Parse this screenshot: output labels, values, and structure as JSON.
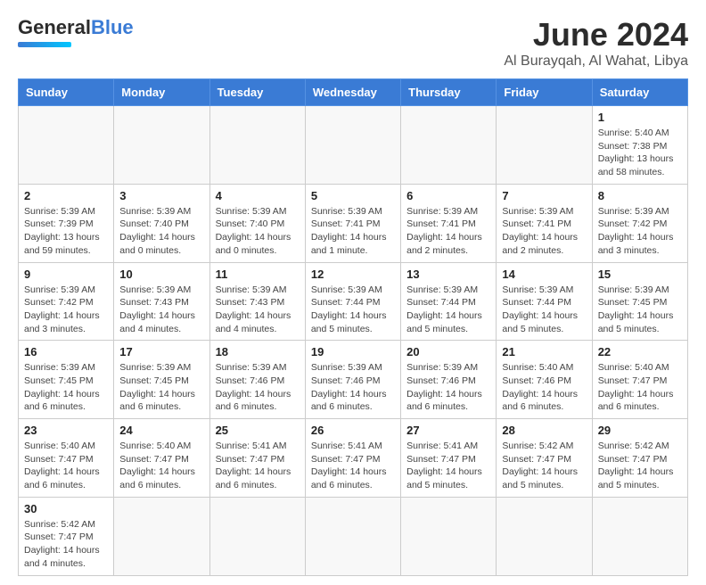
{
  "header": {
    "logo_general": "General",
    "logo_blue": "Blue",
    "title": "June 2024",
    "subtitle": "Al Burayqah, Al Wahat, Libya"
  },
  "days_of_week": [
    "Sunday",
    "Monday",
    "Tuesday",
    "Wednesday",
    "Thursday",
    "Friday",
    "Saturday"
  ],
  "weeks": [
    [
      {
        "day": "",
        "info": ""
      },
      {
        "day": "",
        "info": ""
      },
      {
        "day": "",
        "info": ""
      },
      {
        "day": "",
        "info": ""
      },
      {
        "day": "",
        "info": ""
      },
      {
        "day": "",
        "info": ""
      },
      {
        "day": "1",
        "info": "Sunrise: 5:40 AM\nSunset: 7:38 PM\nDaylight: 13 hours and 58 minutes."
      }
    ],
    [
      {
        "day": "2",
        "info": "Sunrise: 5:39 AM\nSunset: 7:39 PM\nDaylight: 13 hours and 59 minutes."
      },
      {
        "day": "3",
        "info": "Sunrise: 5:39 AM\nSunset: 7:40 PM\nDaylight: 14 hours and 0 minutes."
      },
      {
        "day": "4",
        "info": "Sunrise: 5:39 AM\nSunset: 7:40 PM\nDaylight: 14 hours and 0 minutes."
      },
      {
        "day": "5",
        "info": "Sunrise: 5:39 AM\nSunset: 7:41 PM\nDaylight: 14 hours and 1 minute."
      },
      {
        "day": "6",
        "info": "Sunrise: 5:39 AM\nSunset: 7:41 PM\nDaylight: 14 hours and 2 minutes."
      },
      {
        "day": "7",
        "info": "Sunrise: 5:39 AM\nSunset: 7:41 PM\nDaylight: 14 hours and 2 minutes."
      },
      {
        "day": "8",
        "info": "Sunrise: 5:39 AM\nSunset: 7:42 PM\nDaylight: 14 hours and 3 minutes."
      }
    ],
    [
      {
        "day": "9",
        "info": "Sunrise: 5:39 AM\nSunset: 7:42 PM\nDaylight: 14 hours and 3 minutes."
      },
      {
        "day": "10",
        "info": "Sunrise: 5:39 AM\nSunset: 7:43 PM\nDaylight: 14 hours and 4 minutes."
      },
      {
        "day": "11",
        "info": "Sunrise: 5:39 AM\nSunset: 7:43 PM\nDaylight: 14 hours and 4 minutes."
      },
      {
        "day": "12",
        "info": "Sunrise: 5:39 AM\nSunset: 7:44 PM\nDaylight: 14 hours and 5 minutes."
      },
      {
        "day": "13",
        "info": "Sunrise: 5:39 AM\nSunset: 7:44 PM\nDaylight: 14 hours and 5 minutes."
      },
      {
        "day": "14",
        "info": "Sunrise: 5:39 AM\nSunset: 7:44 PM\nDaylight: 14 hours and 5 minutes."
      },
      {
        "day": "15",
        "info": "Sunrise: 5:39 AM\nSunset: 7:45 PM\nDaylight: 14 hours and 5 minutes."
      }
    ],
    [
      {
        "day": "16",
        "info": "Sunrise: 5:39 AM\nSunset: 7:45 PM\nDaylight: 14 hours and 6 minutes."
      },
      {
        "day": "17",
        "info": "Sunrise: 5:39 AM\nSunset: 7:45 PM\nDaylight: 14 hours and 6 minutes."
      },
      {
        "day": "18",
        "info": "Sunrise: 5:39 AM\nSunset: 7:46 PM\nDaylight: 14 hours and 6 minutes."
      },
      {
        "day": "19",
        "info": "Sunrise: 5:39 AM\nSunset: 7:46 PM\nDaylight: 14 hours and 6 minutes."
      },
      {
        "day": "20",
        "info": "Sunrise: 5:39 AM\nSunset: 7:46 PM\nDaylight: 14 hours and 6 minutes."
      },
      {
        "day": "21",
        "info": "Sunrise: 5:40 AM\nSunset: 7:46 PM\nDaylight: 14 hours and 6 minutes."
      },
      {
        "day": "22",
        "info": "Sunrise: 5:40 AM\nSunset: 7:47 PM\nDaylight: 14 hours and 6 minutes."
      }
    ],
    [
      {
        "day": "23",
        "info": "Sunrise: 5:40 AM\nSunset: 7:47 PM\nDaylight: 14 hours and 6 minutes."
      },
      {
        "day": "24",
        "info": "Sunrise: 5:40 AM\nSunset: 7:47 PM\nDaylight: 14 hours and 6 minutes."
      },
      {
        "day": "25",
        "info": "Sunrise: 5:41 AM\nSunset: 7:47 PM\nDaylight: 14 hours and 6 minutes."
      },
      {
        "day": "26",
        "info": "Sunrise: 5:41 AM\nSunset: 7:47 PM\nDaylight: 14 hours and 6 minutes."
      },
      {
        "day": "27",
        "info": "Sunrise: 5:41 AM\nSunset: 7:47 PM\nDaylight: 14 hours and 5 minutes."
      },
      {
        "day": "28",
        "info": "Sunrise: 5:42 AM\nSunset: 7:47 PM\nDaylight: 14 hours and 5 minutes."
      },
      {
        "day": "29",
        "info": "Sunrise: 5:42 AM\nSunset: 7:47 PM\nDaylight: 14 hours and 5 minutes."
      }
    ],
    [
      {
        "day": "30",
        "info": "Sunrise: 5:42 AM\nSunset: 7:47 PM\nDaylight: 14 hours and 4 minutes."
      },
      {
        "day": "",
        "info": ""
      },
      {
        "day": "",
        "info": ""
      },
      {
        "day": "",
        "info": ""
      },
      {
        "day": "",
        "info": ""
      },
      {
        "day": "",
        "info": ""
      },
      {
        "day": "",
        "info": ""
      }
    ]
  ]
}
